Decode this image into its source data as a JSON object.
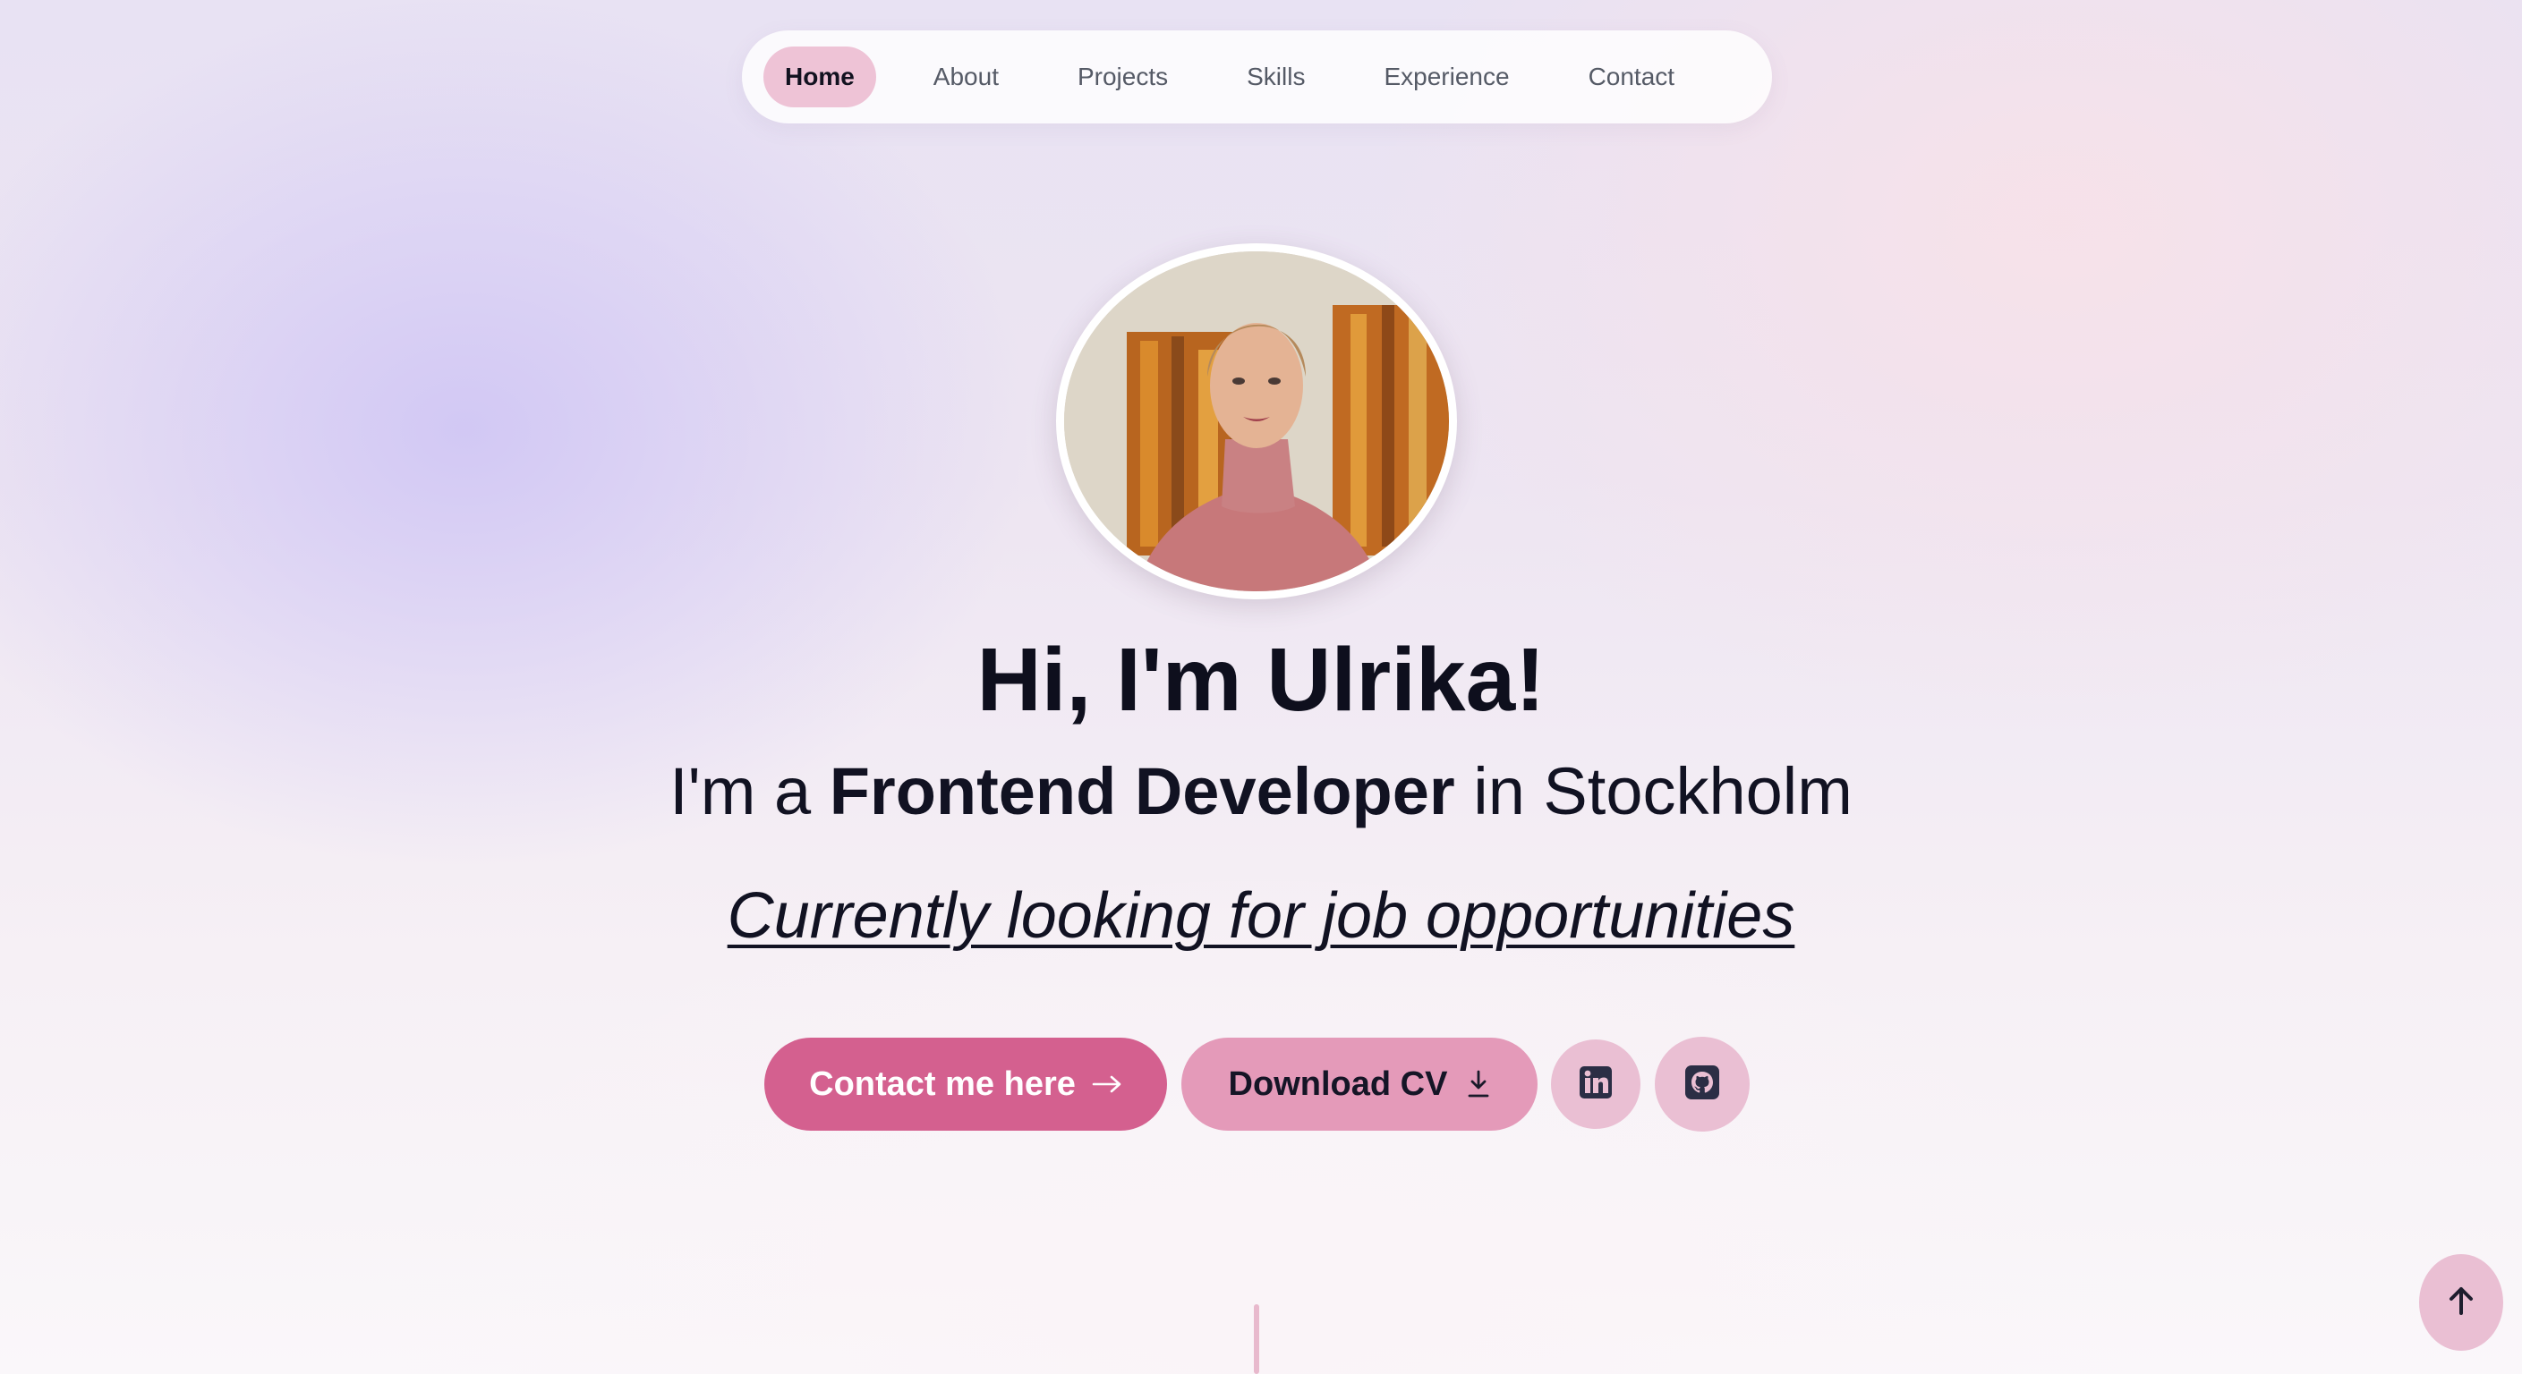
{
  "nav": {
    "items": [
      {
        "label": "Home",
        "active": true
      },
      {
        "label": "About",
        "active": false
      },
      {
        "label": "Projects",
        "active": false
      },
      {
        "label": "Skills",
        "active": false
      },
      {
        "label": "Experience",
        "active": false
      },
      {
        "label": "Contact",
        "active": false
      }
    ]
  },
  "hero": {
    "title": "Hi, I'm Ulrika!",
    "subtitle_prefix": "I'm a ",
    "subtitle_role": "Frontend Developer",
    "subtitle_suffix": " in Stockholm",
    "tagline": "Currently looking for job opportunities"
  },
  "actions": {
    "contact_label": "Contact me here",
    "contact_icon": "arrow-right-icon",
    "cv_label": "Download CV",
    "cv_icon": "download-icon",
    "linkedin_icon": "linkedin-icon",
    "github_icon": "github-icon"
  },
  "scroll_top_icon": "arrow-up-icon",
  "colors": {
    "accent": "#d4608f",
    "accent_light": "#e49ab9",
    "pill": "#eabfd3",
    "text": "#0e0f1d"
  }
}
